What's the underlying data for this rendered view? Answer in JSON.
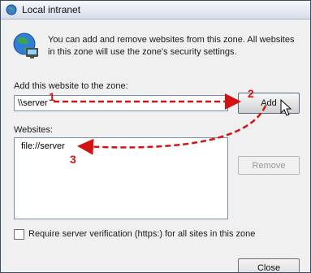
{
  "window": {
    "title": "Local intranet",
    "title_icon": "globe-zone-icon"
  },
  "info": {
    "icon": "globe-network-icon",
    "text": "You can add and remove websites from this zone. All websites in this zone will use the zone's security settings."
  },
  "add_section": {
    "label": "Add this website to the zone:",
    "input_value": "\\\\server",
    "add_button": "Add"
  },
  "websites_section": {
    "label": "Websites:",
    "items": [
      "file://server"
    ],
    "remove_button": "Remove"
  },
  "https_checkbox": {
    "label": "Require server verification (https:) for all sites in this zone",
    "checked": false
  },
  "footer": {
    "close_button": "Close"
  },
  "annotations": {
    "steps": [
      "1",
      "2",
      "3"
    ],
    "color": "#d31313"
  }
}
